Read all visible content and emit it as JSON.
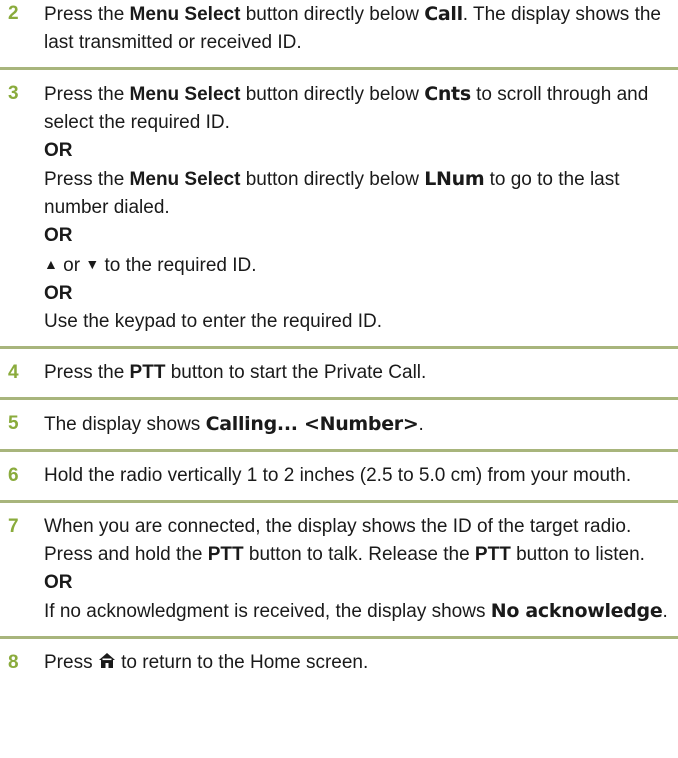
{
  "steps": [
    {
      "number": "2",
      "t1": "Press the ",
      "b1": "Menu Select",
      "t2": " button directly below ",
      "lcd1": "Call",
      "t3": ". The display shows the last transmitted or received ID."
    },
    {
      "number": "3",
      "p1": {
        "t1": "Press the ",
        "b1": "Menu Select",
        "t2": " button directly below ",
        "lcd1": "Cnts",
        "t3": " to scroll through and select the required ID."
      },
      "or1": "OR",
      "p2": {
        "t1": "Press the ",
        "b1": "Menu Select",
        "t2": " button directly below ",
        "lcd1": "LNum",
        "t3": " to go to the last number dialed."
      },
      "or2": "OR",
      "p3": {
        "up": "▲",
        "or_text": " or ",
        "down": "▼",
        "t1": " to the required ID."
      },
      "or3": "OR",
      "p4": "Use the keypad to enter the required ID."
    },
    {
      "number": "4",
      "t1": "Press the ",
      "b1": "PTT",
      "t2": " button to start the Private Call."
    },
    {
      "number": "5",
      "t1": "The display shows ",
      "lcd1": "Calling... <Number>",
      "t2": "."
    },
    {
      "number": "6",
      "t1": "Hold the radio vertically 1 to 2 inches (2.5 to 5.0 cm) from your mouth."
    },
    {
      "number": "7",
      "t1": "When you are connected, the display shows the ID of the target radio. Press and hold the ",
      "b1": "PTT",
      "t2": " button to talk. Release the ",
      "b2": "PTT",
      "t3": " button to listen.",
      "or1": "OR",
      "t4": "If no acknowledgment is received, the display shows ",
      "lcd1": "No acknowledge",
      "t5": "."
    },
    {
      "number": "8",
      "t1": "Press ",
      "icon": "home-icon",
      "t2": " to return to the Home screen."
    }
  ],
  "colors": {
    "accent_number": "#8aab3c",
    "divider": "#a8b57c"
  }
}
